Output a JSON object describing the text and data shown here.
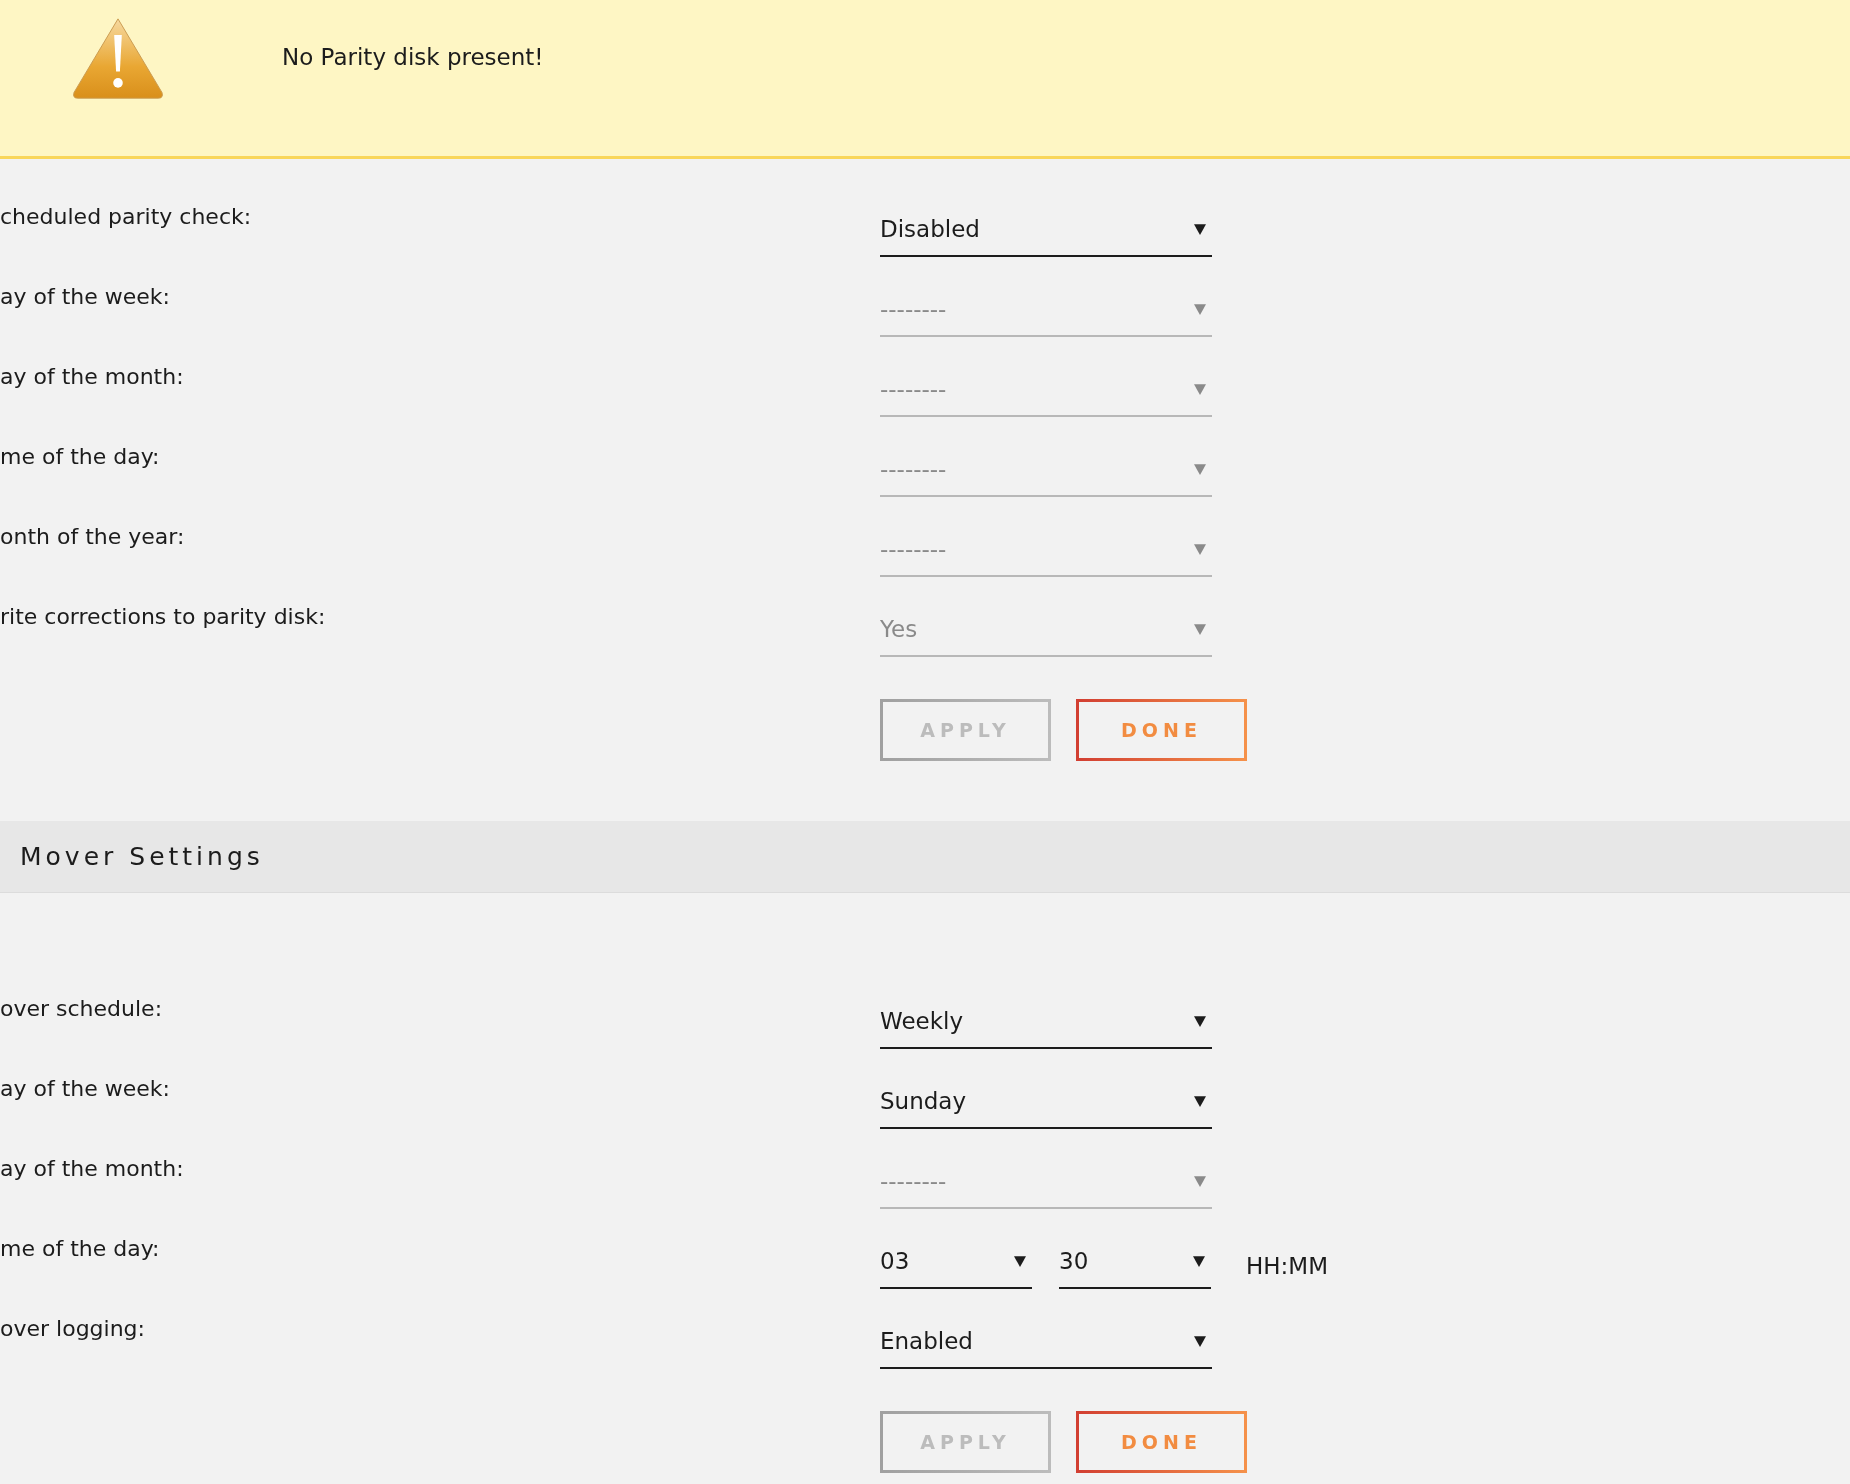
{
  "banner": {
    "message": "No Parity disk present!"
  },
  "sections": [
    {
      "rows": [
        {
          "kind": "select",
          "label": "cheduled parity check:",
          "selects": [
            {
              "value": "Disabled",
              "disabled": false
            }
          ]
        },
        {
          "kind": "select",
          "label": "ay of the week:",
          "selects": [
            {
              "value": "--------",
              "disabled": true
            }
          ]
        },
        {
          "kind": "select",
          "label": "ay of the month:",
          "selects": [
            {
              "value": "--------",
              "disabled": true
            }
          ]
        },
        {
          "kind": "select",
          "label": "me of the day:",
          "selects": [
            {
              "value": "--------",
              "disabled": true
            }
          ]
        },
        {
          "kind": "select",
          "label": "onth of the year:",
          "selects": [
            {
              "value": "--------",
              "disabled": true
            }
          ]
        },
        {
          "kind": "select",
          "label": "rite corrections to parity disk:",
          "selects": [
            {
              "value": "Yes",
              "disabled": true
            }
          ]
        }
      ],
      "buttons": [
        {
          "label": "APPLY",
          "disabled": true
        },
        {
          "label": "DONE",
          "disabled": false
        }
      ]
    },
    {
      "title": "Mover Settings",
      "rows": [
        {
          "kind": "select",
          "label": "over schedule:",
          "selects": [
            {
              "value": "Weekly",
              "disabled": false
            }
          ]
        },
        {
          "kind": "select",
          "label": "ay of the week:",
          "selects": [
            {
              "value": "Sunday",
              "disabled": false
            }
          ]
        },
        {
          "kind": "select",
          "label": "ay of the month:",
          "selects": [
            {
              "value": "--------",
              "disabled": true
            }
          ]
        },
        {
          "kind": "time",
          "label": "me of the day:",
          "selects": [
            {
              "value": "03",
              "disabled": false
            },
            {
              "value": "30",
              "disabled": false
            }
          ],
          "unit": "HH:MM"
        },
        {
          "kind": "select",
          "label": "over logging:",
          "selects": [
            {
              "value": "Enabled",
              "disabled": false
            }
          ]
        }
      ],
      "buttons": [
        {
          "label": "APPLY",
          "disabled": true
        },
        {
          "label": "DONE",
          "disabled": false
        }
      ]
    }
  ]
}
